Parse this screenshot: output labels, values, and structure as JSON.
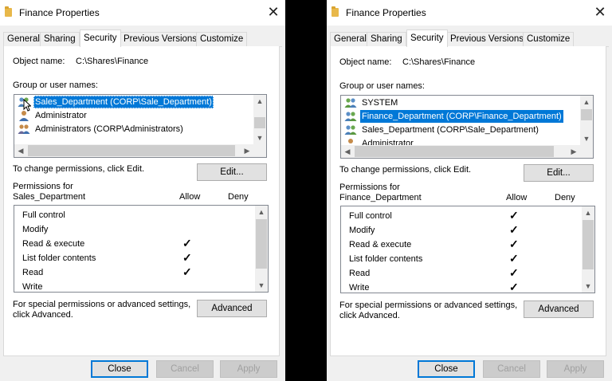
{
  "dialogs": [
    {
      "title": "Finance Properties",
      "tabs": [
        "General",
        "Sharing",
        "Security",
        "Previous Versions",
        "Customize"
      ],
      "active_tab": "Security",
      "object_name_label": "Object name:",
      "object_name_value": "C:\\Shares\\Finance",
      "group_label": "Group or user names:",
      "users": [
        {
          "name": "Sales_Department (CORP\\Sale_Department)",
          "icon": "group-icon",
          "selected": true
        },
        {
          "name": "Administrator",
          "icon": "user-icon",
          "selected": false
        },
        {
          "name": "Administrators (CORP\\Administrators)",
          "icon": "group-icon",
          "selected": false
        }
      ],
      "change_text": "To change permissions, click Edit.",
      "edit_label": "Edit...",
      "permissions_for_label": "Permissions for",
      "permissions_for_name": "Sales_Department",
      "allow_label": "Allow",
      "deny_label": "Deny",
      "permissions": [
        {
          "name": "Full control",
          "allow": false,
          "deny": false
        },
        {
          "name": "Modify",
          "allow": false,
          "deny": false
        },
        {
          "name": "Read & execute",
          "allow": true,
          "deny": false
        },
        {
          "name": "List folder contents",
          "allow": true,
          "deny": false
        },
        {
          "name": "Read",
          "allow": true,
          "deny": false
        },
        {
          "name": "Write",
          "allow": false,
          "deny": false
        }
      ],
      "special_text_1": "For special permissions or advanced settings,",
      "special_text_2": "click Advanced.",
      "advanced_label": "Advanced",
      "close_label": "Close",
      "cancel_label": "Cancel",
      "apply_label": "Apply"
    },
    {
      "title": "Finance Properties",
      "tabs": [
        "General",
        "Sharing",
        "Security",
        "Previous Versions",
        "Customize"
      ],
      "active_tab": "Security",
      "object_name_label": "Object name:",
      "object_name_value": "C:\\Shares\\Finance",
      "group_label": "Group or user names:",
      "users": [
        {
          "name": "SYSTEM",
          "icon": "group-icon",
          "selected": false
        },
        {
          "name": "Finance_Department (CORP\\Finance_Department)",
          "icon": "group-icon",
          "selected": true
        },
        {
          "name": "Sales_Department (CORP\\Sale_Department)",
          "icon": "group-icon",
          "selected": false
        },
        {
          "name": "Administrator",
          "icon": "user-icon",
          "selected": false
        }
      ],
      "change_text": "To change permissions, click Edit.",
      "edit_label": "Edit...",
      "permissions_for_label": "Permissions for",
      "permissions_for_name": "Finance_Department",
      "allow_label": "Allow",
      "deny_label": "Deny",
      "permissions": [
        {
          "name": "Full control",
          "allow": true,
          "deny": false
        },
        {
          "name": "Modify",
          "allow": true,
          "deny": false
        },
        {
          "name": "Read & execute",
          "allow": true,
          "deny": false
        },
        {
          "name": "List folder contents",
          "allow": true,
          "deny": false
        },
        {
          "name": "Read",
          "allow": true,
          "deny": false
        },
        {
          "name": "Write",
          "allow": true,
          "deny": false
        }
      ],
      "special_text_1": "For special permissions or advanced settings,",
      "special_text_2": "click Advanced.",
      "advanced_label": "Advanced",
      "close_label": "Close",
      "cancel_label": "Cancel",
      "apply_label": "Apply"
    }
  ],
  "colors": {
    "selection": "#0078d7",
    "dialog_bg": "#f0f0f0",
    "backdrop": "#000000"
  },
  "checkmark_glyph": "✓"
}
